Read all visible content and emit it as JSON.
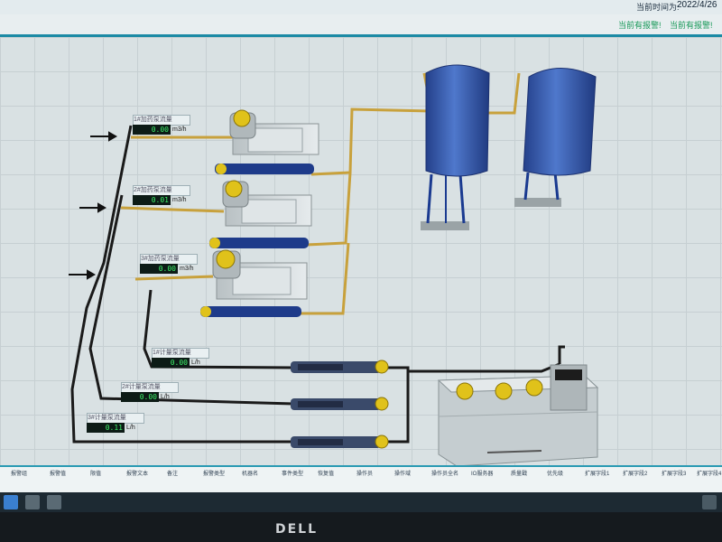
{
  "header": {
    "clock_label": "当前时间为:",
    "date": "2022/4/26",
    "alarms": [
      "当前有报警!",
      "当前有报警!"
    ]
  },
  "readouts": [
    {
      "label": "1#加药泵流量",
      "value": "0.00",
      "unit": "m3/h"
    },
    {
      "label": "2#加药泵流量",
      "value": "0.01",
      "unit": "m3/h"
    },
    {
      "label": "3#加药泵流量",
      "value": "0.00",
      "unit": "m3/h"
    },
    {
      "label": "1#计量泵流量",
      "value": "0.00",
      "unit": "L/h"
    },
    {
      "label": "2#计量泵流量",
      "value": "0.00",
      "unit": "L/h"
    },
    {
      "label": "3#计量泵流量",
      "value": "0.11",
      "unit": "L/h"
    }
  ],
  "alarm_table": {
    "columns": [
      "报警组",
      "报警值",
      "限值",
      "报警文本",
      "备注",
      "报警类型",
      "机器名",
      "事件类型",
      "恢复值",
      "操作员",
      "操作域",
      "操作员全名",
      "IO服务器",
      "质量戳",
      "优先级",
      "扩展字段1",
      "扩展字段2",
      "扩展字段3",
      "扩展字段4"
    ]
  },
  "monitor": {
    "brand": "DELL"
  },
  "colors": {
    "pipe_yellow": "#c8a13c",
    "pipe_black": "#1a1a1a",
    "tank_blue": "#3a5fb0",
    "motor_yellow": "#e0c21a",
    "value_green": "#3ef16a"
  }
}
